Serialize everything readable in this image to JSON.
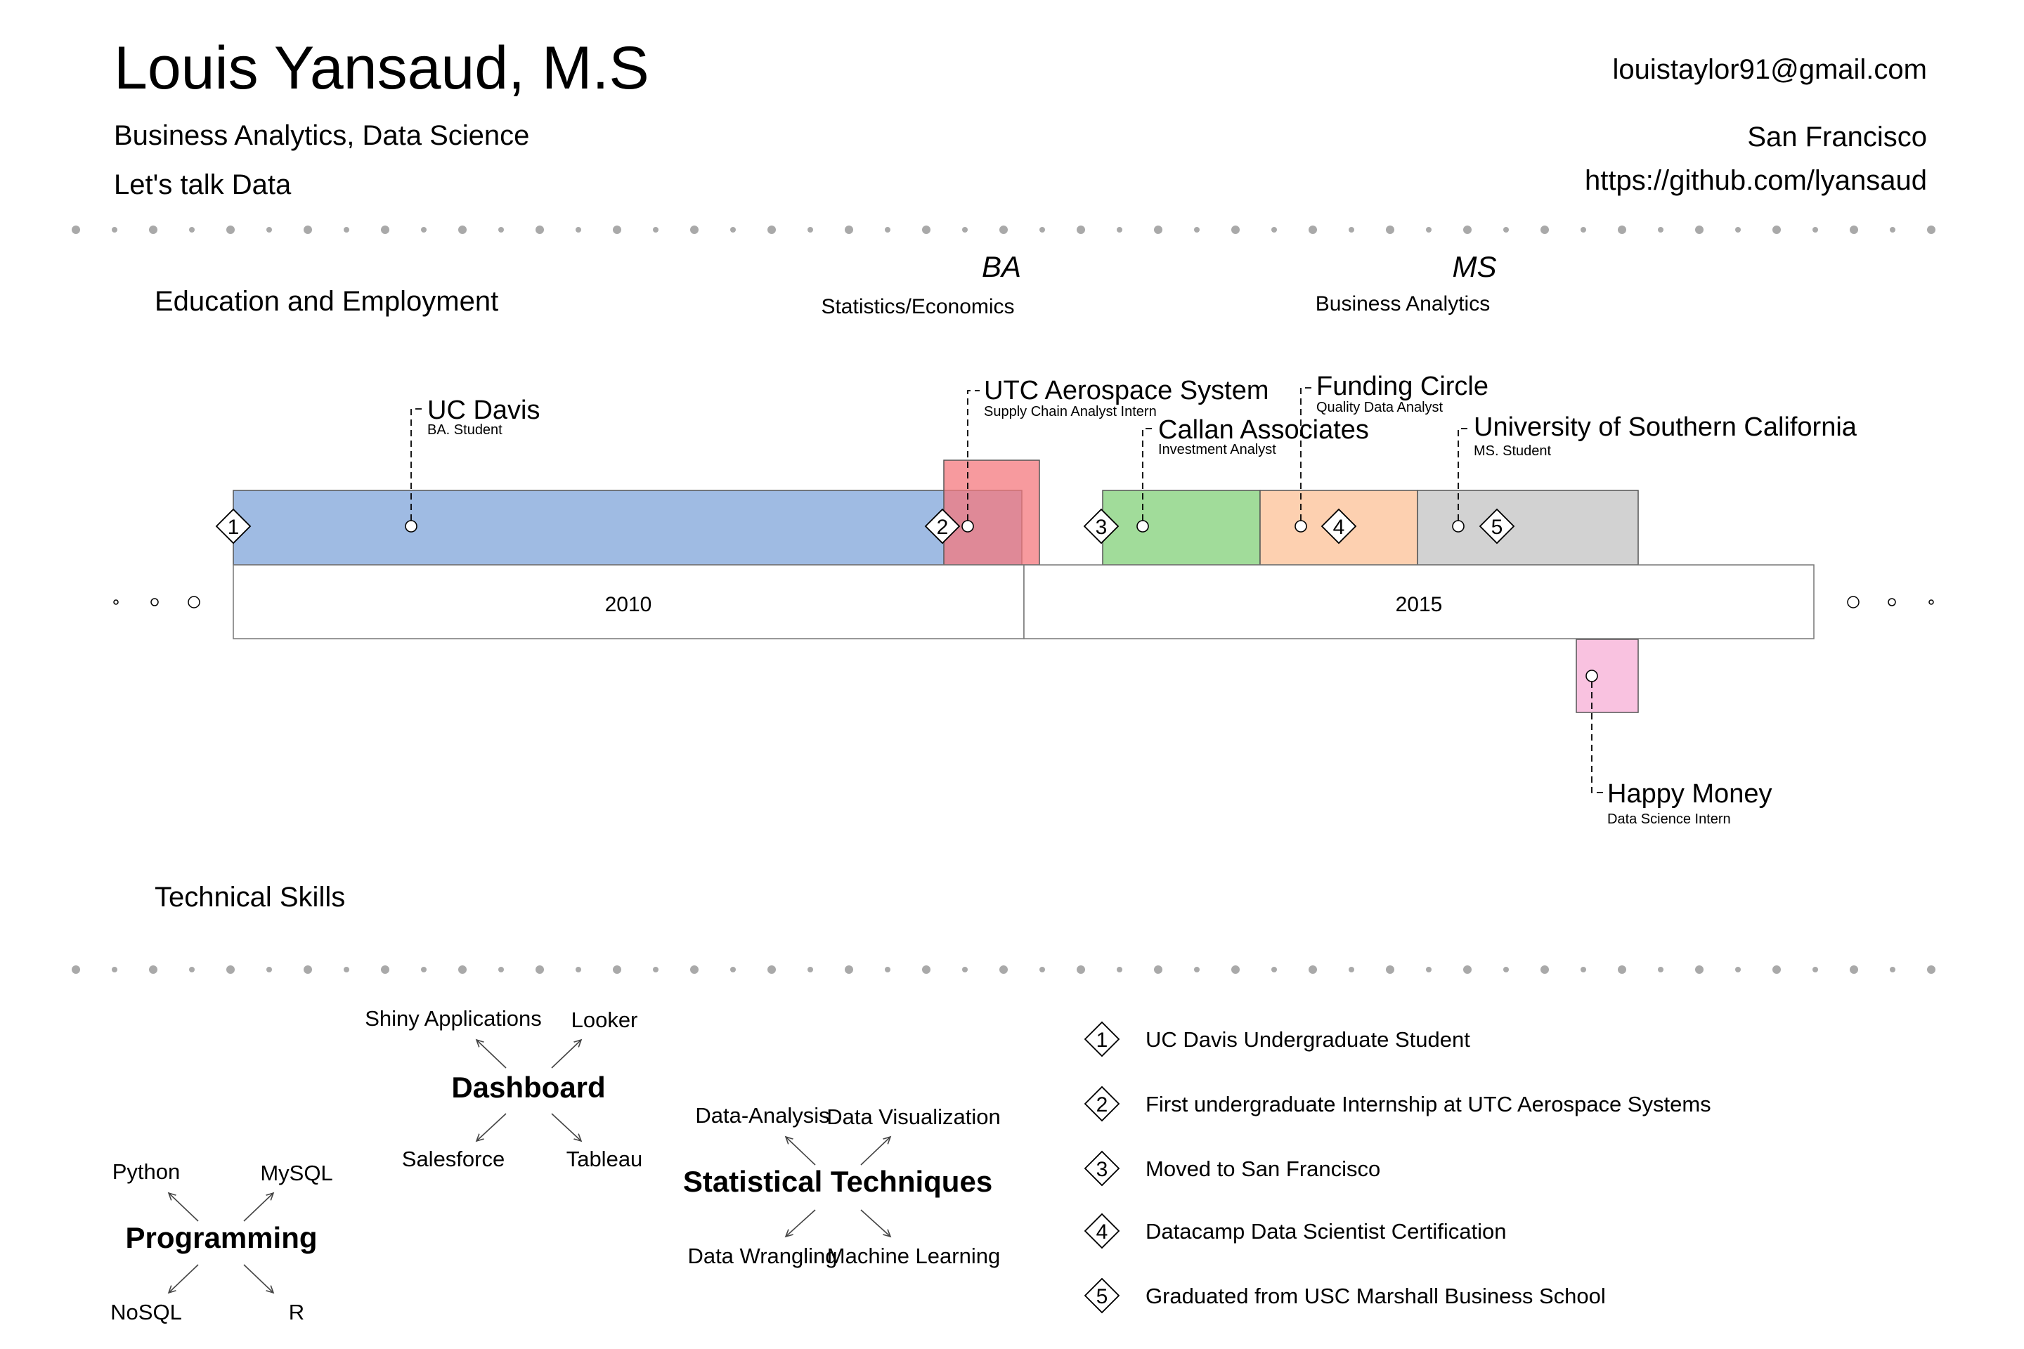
{
  "header": {
    "name": "Louis Yansaud, M.S",
    "subtitle": "Business Analytics, Data Science",
    "tagline": "Let's talk Data",
    "email": "louistaylor91@gmail.com",
    "location": "San Francisco",
    "github": "https://github.com/lyansaud"
  },
  "sections": {
    "education_employment": "Education and Employment",
    "technical_skills": "Technical Skills"
  },
  "degrees": [
    {
      "degree": "BA",
      "field": "Statistics/Economics"
    },
    {
      "degree": "MS",
      "field": "Business Analytics"
    }
  ],
  "timeline": {
    "years": [
      "2010",
      "2015"
    ],
    "events": [
      {
        "title": "UC Davis",
        "role": "BA. Student",
        "color": "#9fbbe3"
      },
      {
        "title": "UTC Aerospace System",
        "role": "Supply Chain Analyst Intern",
        "color": "#f4787d"
      },
      {
        "title": "Callan Associates",
        "role": "Investment Analyst",
        "color": "#a1dc9a"
      },
      {
        "title": "Funding Circle",
        "role": "Quality Data Analyst",
        "color": "#fdd0b0"
      },
      {
        "title": "University of Southern California",
        "role": "MS. Student",
        "color": "#d2d2d2"
      },
      {
        "title": "Happy Money",
        "role": "Data Science Intern",
        "color": "#f9c2e0"
      }
    ],
    "milestone_numbers": [
      "1",
      "2",
      "3",
      "4",
      "5"
    ]
  },
  "skills": {
    "dashboard": {
      "title": "Dashboard",
      "items": [
        "Shiny Applications",
        "Looker",
        "Salesforce",
        "Tableau"
      ]
    },
    "statistical": {
      "title": "Statistical Techniques",
      "items": [
        "Data-Analysis",
        "Data Visualization",
        "Data Wrangling",
        "Machine Learning"
      ]
    },
    "programming": {
      "title": "Programming",
      "items": [
        "Python",
        "MySQL",
        "NoSQL",
        "R"
      ]
    }
  },
  "milestones": [
    {
      "number": "1",
      "text": "UC Davis Undergraduate Student"
    },
    {
      "number": "2",
      "text": "First undergraduate Internship at UTC Aerospace Systems"
    },
    {
      "number": "3",
      "text": "Moved to San Francisco"
    },
    {
      "number": "4",
      "text": "Datacamp Data Scientist Certification"
    },
    {
      "number": "5",
      "text": "Graduated from USC Marshall Business School"
    }
  ]
}
